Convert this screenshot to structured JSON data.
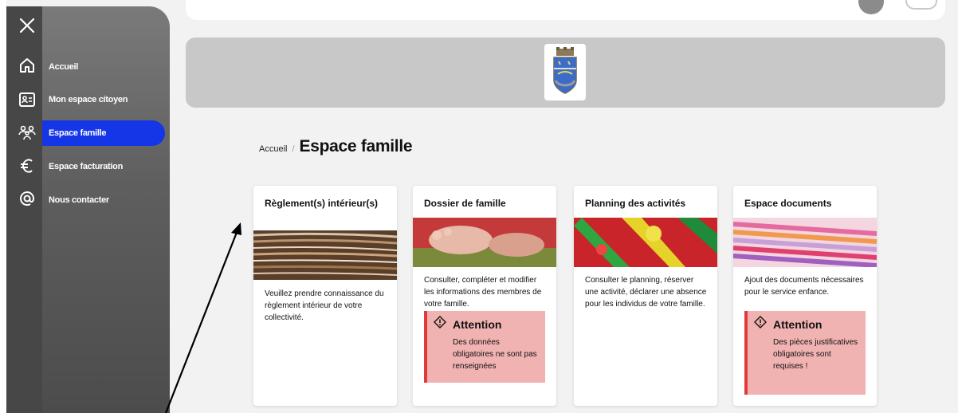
{
  "sidebar": {
    "items": [
      {
        "label": "Accueil",
        "icon": "home-icon"
      },
      {
        "label": "Mon espace citoyen",
        "icon": "id-card-icon"
      },
      {
        "label": "Espace famille",
        "icon": "family-icon",
        "active": true
      },
      {
        "label": "Espace facturation",
        "icon": "euro-icon"
      },
      {
        "label": "Nous contacter",
        "icon": "at-icon"
      }
    ],
    "active_color": "#1536e6"
  },
  "breadcrumb": {
    "home": "Accueil",
    "separator": "/",
    "current": "Espace famille"
  },
  "cards": [
    {
      "title": "Règlement(s) intérieur(s)",
      "image": "stacked-papers-image",
      "text": "Veuillez prendre connaissance du règlement intérieur de votre collectivité."
    },
    {
      "title": "Dossier de famille",
      "image": "child-feet-image",
      "text": "Consulter, compléter et modifier les informations des membres de votre famille.",
      "alert": {
        "title": "Attention",
        "text": "Des données obligatoires ne sont pas renseignées"
      }
    },
    {
      "title": "Planning des activités",
      "image": "painting-image",
      "text": "Consulter le planning, réserver une activité, déclarer une absence pour les individus de votre famille."
    },
    {
      "title": "Espace documents",
      "image": "folders-image",
      "text": "Ajout des documents nécessaires pour le service enfance.",
      "alert": {
        "title": "Attention",
        "text": "Des pièces justificatives obligatoires sont requises !"
      }
    }
  ],
  "colors": {
    "alert_bg": "#f1b2b2",
    "alert_border": "#e03b3b",
    "banner": "#c8c8c8"
  }
}
